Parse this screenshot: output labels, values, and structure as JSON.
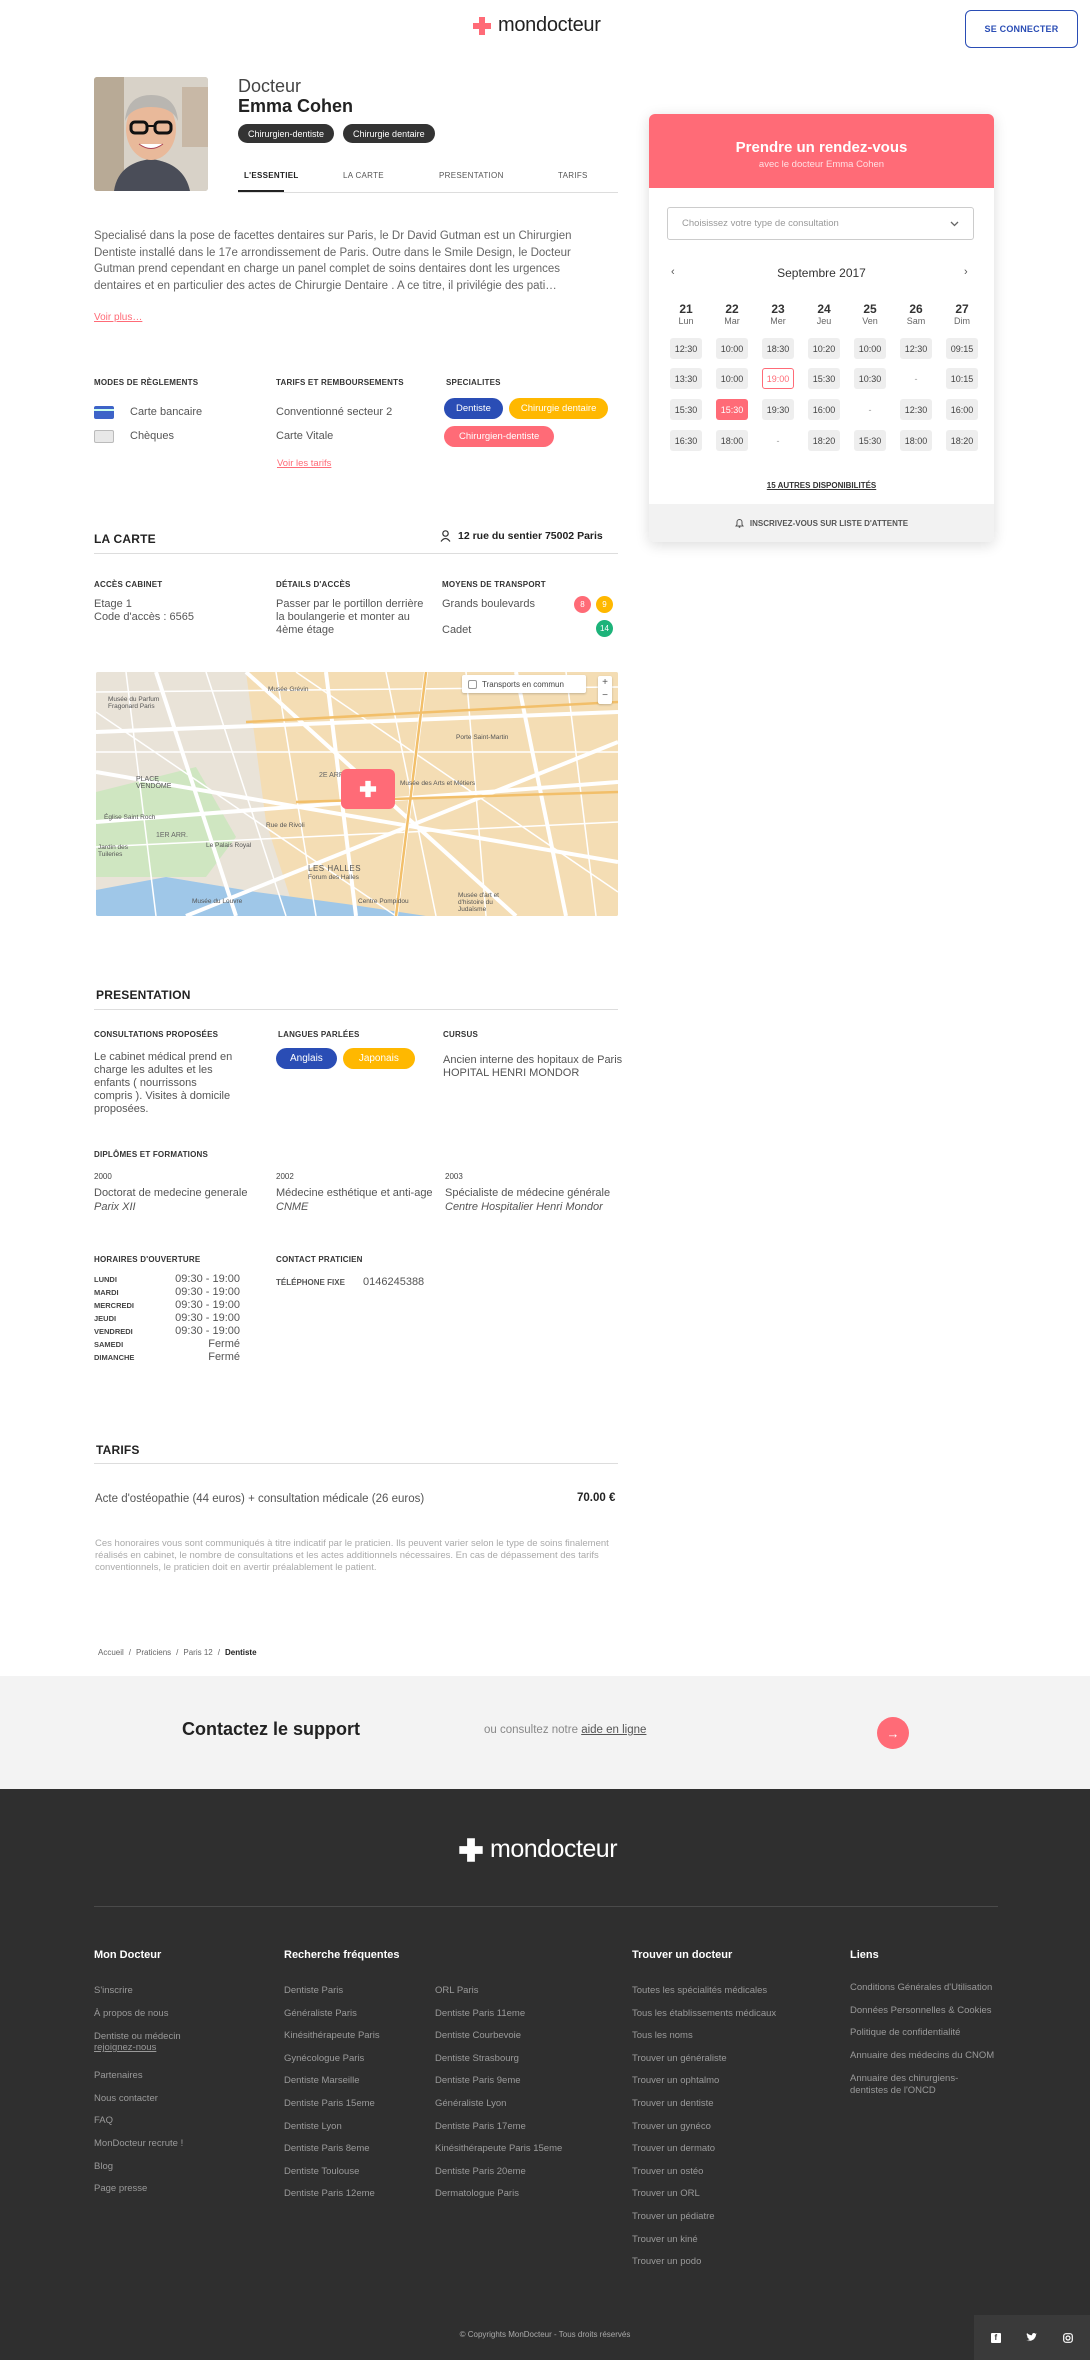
{
  "header": {
    "logo": "mondocteur",
    "connect_label": "SE CONNECTER"
  },
  "profile": {
    "title": "Docteur",
    "name": "Emma Cohen",
    "tags": [
      "Chirurgien-dentiste",
      "Chirurgie dentaire"
    ],
    "tabs": [
      "L'ESSENTIEL",
      "LA CARTE",
      "PRESENTATION",
      "TARIFS"
    ]
  },
  "bio": {
    "lines": [
      "Specialisé dans la pose de facettes dentaires sur Paris, le Dr David Gutman est un Chirurgien",
      "Dentiste installé dans le 17e arrondissement de Paris. Outre dans le Smile Design, le Docteur",
      "Gutman prend cependant en charge un panel complet de soins dentaires dont les urgences",
      "dentaires et en particulier des actes de Chirurgie Dentaire . A ce titre, il privilégie des pati…"
    ],
    "more": "Voir plus…"
  },
  "payments": {
    "title": "MODES DE RÈGLEMENTS",
    "items": [
      "Carte bancaire",
      "Chèques"
    ]
  },
  "tarifs_remb": {
    "title": "TARIFS ET REMBOURSEMENTS",
    "items": [
      "Conventionné secteur 2",
      "Carte Vitale"
    ],
    "link": "Voir les tarifs"
  },
  "specialites": {
    "title": "SPECIALITES",
    "items": [
      "Dentiste",
      "Chirurgie dentaire",
      "Chirurgien-dentiste"
    ]
  },
  "carte": {
    "title": "LA CARTE",
    "address": "12 rue du sentier 75002 Paris",
    "acces_title": "ACCÈS CABINET",
    "acces_lines": [
      "Etage 1",
      "Code d'accès : 6565"
    ],
    "details_title": "DÉTAILS D'ACCÈS",
    "details_lines": [
      "Passer par le portillon derrière",
      "la boulangerie et monter au",
      "4ème étage"
    ],
    "transport_title": "MOYENS DE TRANSPORT",
    "transports": [
      {
        "name": "Grands boulevards",
        "lines": [
          "8",
          "9"
        ]
      },
      {
        "name": "Cadet",
        "lines": [
          "14"
        ]
      }
    ],
    "map_toggle": "Transports en commun",
    "map_labels": [
      "Musée du Parfum Fragonard Paris",
      "Musée Grévin",
      "PLACE VENDÔME",
      "2E ARR.",
      "Porte Saint-Martin",
      "Musée des Arts et Métiers",
      "1ER ARR.",
      "Le Palais Royal",
      "Église Saint Roch",
      "Jardin des Tuileries",
      "LES HALLES",
      "Forum des Halles",
      "Musée du Louvre",
      "Centre Pompidou",
      "Musée d'art et d'histoire du Judaïsme",
      "Rue de Rivoli"
    ]
  },
  "presentation": {
    "title": "PRESENTATION",
    "consult_title": "CONSULTATIONS PROPOSÉES",
    "consult_lines": [
      "Le cabinet médical prend en",
      "charge les adultes et les",
      "enfants ( nourrissons",
      "compris ). Visites à domicile",
      "proposées."
    ],
    "langues_title": "LANGUES PARLÉES",
    "langues": [
      "Anglais",
      "Japonais"
    ],
    "cursus_title": "CURSUS",
    "cursus_lines": [
      "Ancien interne des hopitaux de Paris",
      "HOPITAL HENRI MONDOR"
    ],
    "diplomes_title": "DIPLÔMES ET FORMATIONS",
    "diplomes": [
      {
        "year": "2000",
        "name": "Doctorat de medecine generale",
        "school": "Parix XII"
      },
      {
        "year": "2002",
        "name": "Médecine esthétique et anti-age",
        "school": "CNME"
      },
      {
        "year": "2003",
        "name": "Spécialiste de médecine générale",
        "school": "Centre Hospitalier Henri Mondor"
      }
    ],
    "horaires_title": "HORAIRES D'OUVERTURE",
    "horaires": [
      {
        "day": "LUNDI",
        "hours": "09:30 - 19:00"
      },
      {
        "day": "MARDI",
        "hours": "09:30 - 19:00"
      },
      {
        "day": "MERCREDI",
        "hours": "09:30 - 19:00"
      },
      {
        "day": "JEUDI",
        "hours": "09:30 - 19:00"
      },
      {
        "day": "VENDREDI",
        "hours": "09:30 - 19:00"
      },
      {
        "day": "SAMEDI",
        "hours": "Fermé"
      },
      {
        "day": "DIMANCHE",
        "hours": "Fermé"
      }
    ],
    "contact_title": "CONTACT PRATICIEN",
    "phone_label": "TÉLÉPHONE FIXE",
    "phone": "0146245388"
  },
  "tarifs": {
    "title": "TARIFS",
    "item": "Acte d'ostéopathie (44 euros) + consultation médicale (26 euros)",
    "price": "70.00 €",
    "note_lines": [
      "Ces honoraires vous sont communiqués à titre indicatif par le praticien. Ils peuvent varier selon le type de soins finalement",
      "réalisés en cabinet, le nombre de consultations et les actes additionnels nécessaires. En cas de dépassement des tarifs",
      "conventionnels, le praticien doit en avertir préalablement le patient."
    ]
  },
  "breadcrumb": [
    "Accueil",
    "Praticiens",
    "Paris 12",
    "Dentiste"
  ],
  "support": {
    "title": "Contactez le support",
    "text": "ou consultez notre",
    "link": "aide en ligne"
  },
  "booking": {
    "title": "Prendre un rendez-vous",
    "subtitle": "avec le docteur Emma Cohen",
    "select_placeholder": "Choisissez votre type de consultation",
    "month": "Septembre 2017",
    "days": [
      {
        "num": "21",
        "name": "Lun",
        "slots": [
          "12:30",
          "13:30",
          "15:30",
          "16:30"
        ]
      },
      {
        "num": "22",
        "name": "Mar",
        "slots": [
          "10:00",
          "10:00",
          "15:30",
          "18:00"
        ]
      },
      {
        "num": "23",
        "name": "Mer",
        "slots": [
          "18:30",
          "19:00",
          "19:30",
          "-"
        ]
      },
      {
        "num": "24",
        "name": "Jeu",
        "slots": [
          "10:20",
          "15:30",
          "16:00",
          "18:20"
        ]
      },
      {
        "num": "25",
        "name": "Ven",
        "slots": [
          "10:00",
          "10:30",
          "-",
          "15:30"
        ]
      },
      {
        "num": "26",
        "name": "Sam",
        "slots": [
          "12:30",
          "-",
          "12:30",
          "18:00"
        ]
      },
      {
        "num": "27",
        "name": "Dim",
        "slots": [
          "09:15",
          "10:15",
          "16:00",
          "18:20"
        ]
      }
    ],
    "more": "15 AUTRES DISPONIBILITÉS",
    "waitlist": "INSCRIVEZ-VOUS SUR LISTE D'ATTENTE"
  },
  "footer": {
    "logo": "mondocteur",
    "col1": {
      "title": "Mon Docteur",
      "links": [
        "S'inscrire",
        "À propos de nous",
        "Dentiste ou médecin",
        "rejoignez-nous",
        "Partenaires",
        "Nous contacter",
        "FAQ",
        "MonDocteur recrute !",
        "Blog",
        "Page presse"
      ]
    },
    "col2": {
      "title": "Recherche fréquentes",
      "links": [
        "Dentiste Paris",
        "Généraliste Paris",
        "Kinésithérapeute Paris",
        "Gynécologue Paris",
        "Dentiste Marseille",
        "Dentiste Paris 15eme",
        "Dentiste Lyon",
        "Dentiste Paris 8eme",
        "Dentiste Toulouse",
        "Dentiste Paris 12eme"
      ]
    },
    "col3": {
      "links": [
        "ORL Paris",
        "Dentiste Paris 11eme",
        "Dentiste Courbevoie",
        "Dentiste Strasbourg",
        "Dentiste Paris 9eme",
        "Généraliste Lyon",
        "Dentiste Paris 17eme",
        "Kinésithérapeute Paris 15eme",
        "Dentiste Paris 20eme",
        "Dermatologue Paris"
      ]
    },
    "col4": {
      "title": "Trouver un docteur",
      "links": [
        "Toutes les spécialités médicales",
        "Tous les établissements médicaux",
        "Tous les noms",
        "Trouver un généraliste",
        "Trouver un ophtalmo",
        "Trouver un dentiste",
        "Trouver un gynéco",
        "Trouver un dermato",
        "Trouver un ostéo",
        "Trouver un ORL",
        "Trouver un pédiatre",
        "Trouver un kiné",
        "Trouver un podo"
      ]
    },
    "col5": {
      "title": "Liens",
      "links": [
        "Conditions Générales d'Utilisation",
        "Données Personnelles & Cookies",
        "Politique de confidentialité",
        "Annuaire des médecins du CNOM",
        "Annuaire des chirurgiens-",
        "dentistes de l'ONCD"
      ]
    },
    "copyright": "© Copyrights MonDocteur - Tous droits réservés"
  },
  "colors": {
    "brand": "#ff6b77",
    "navy": "#2a4db5",
    "yellow": "#ffb800",
    "dark": "#2f2f2f"
  }
}
